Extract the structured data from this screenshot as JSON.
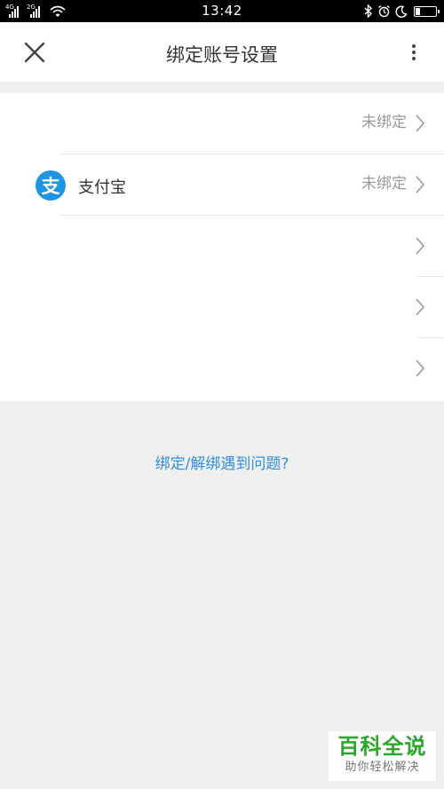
{
  "status_bar": {
    "time": "13:42",
    "sim1_network": "4G",
    "sim2_network": "2G",
    "icons": [
      "bluetooth-icon",
      "alarm-icon",
      "moon-icon",
      "battery-icon"
    ]
  },
  "header": {
    "title": "绑定账号设置",
    "close_icon": "close-icon",
    "more_icon": "more-vertical-icon"
  },
  "accounts": [
    {
      "name": "",
      "status": "未绑定"
    },
    {
      "name": "支付宝",
      "icon_char": "支",
      "status": "未绑定"
    },
    {
      "name": "",
      "status": ""
    },
    {
      "name": "",
      "status": ""
    },
    {
      "name": "",
      "status": ""
    }
  ],
  "help_link": "绑定/解绑遇到问题?",
  "watermark": {
    "title": "百科全说",
    "subtitle": "助你轻松解决"
  },
  "colors": {
    "accent_link": "#2f8fe0",
    "alipay_blue": "#1e95e3",
    "background": "#efefef",
    "watermark_green": "#2aa82a"
  }
}
